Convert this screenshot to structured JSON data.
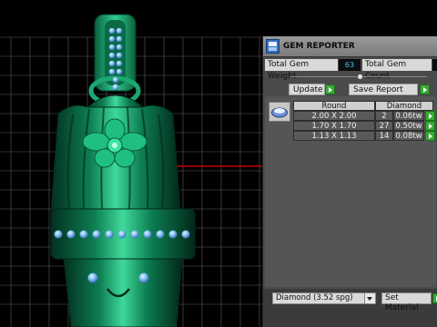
{
  "panel": {
    "title": "GEM REPORTER",
    "total_weight_label": "Total Gem Weight",
    "total_weight_value": "63",
    "total_count_label": "Total Gem Count",
    "update_label": "Update",
    "save_report_label": "Save Report"
  },
  "table": {
    "col_shape": "Round",
    "col_material": "Diamond",
    "rows": [
      {
        "size": "2.00 X 2.00",
        "count": "2",
        "weight": "0.06tw"
      },
      {
        "size": "1.70 X 1.70",
        "count": "27",
        "weight": "0.50tw"
      },
      {
        "size": "1.13 X 1.13",
        "count": "14",
        "weight": "0.08tw"
      }
    ]
  },
  "footer": {
    "material_select": "Diamond     (3.52 spg)",
    "set_material_label": "Set Material"
  },
  "colors": {
    "model_green": "#0f8a5c",
    "gem_blue": "#7fc4ff",
    "accent_arrow": "#3aa935",
    "value_text": "#4ec0e8",
    "axis_red": "#c00000"
  }
}
